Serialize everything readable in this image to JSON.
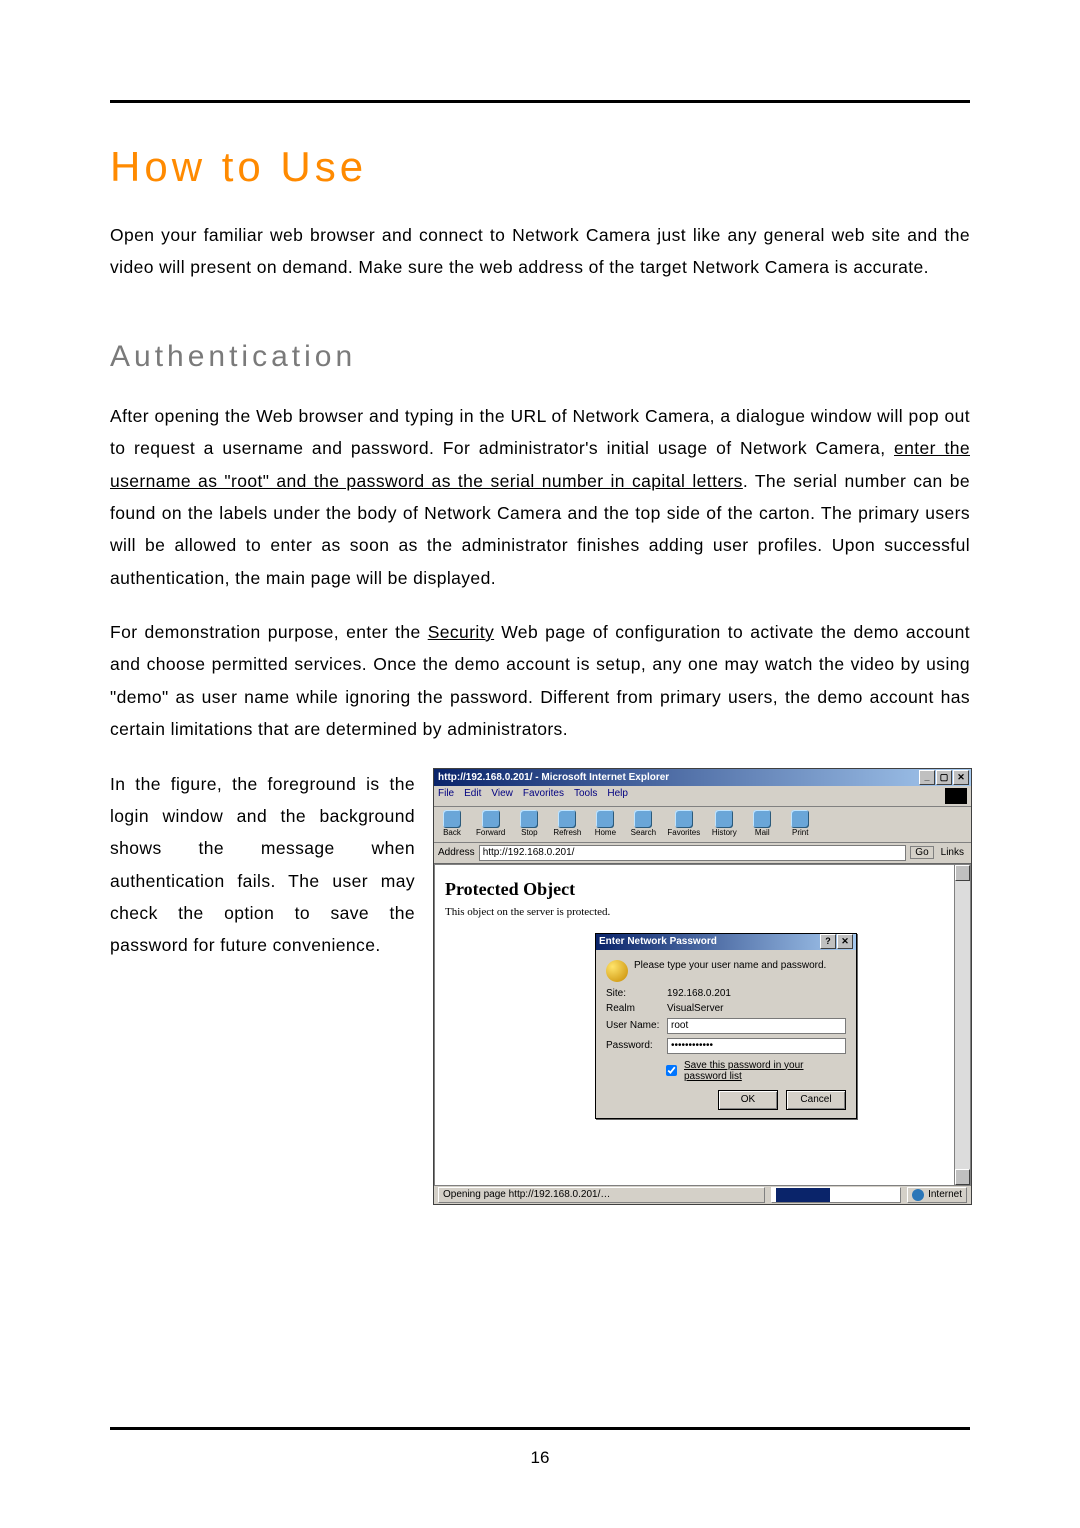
{
  "page_number": "16",
  "title": "How to Use",
  "intro": "Open your familiar web browser and connect to Network Camera just like any general web site and the video will present on demand. Make sure the web address of the target Network Camera is accurate.",
  "section_heading": "Authentication",
  "para1_a": "After opening the Web browser and typing in the URL of Network Camera, a dialogue window will pop out to request a username and password. For administrator's initial usage of Network Camera, ",
  "para1_u": "enter the username as \"root\" and the password as the serial number in capital letters",
  "para1_b": ". The serial number can be found on the labels under the body of Network Camera and the top side of the carton. The primary users will be allowed to enter as soon as the administrator finishes adding user profiles. Upon successful authentication, the main page will be displayed.",
  "para2_a": "For demonstration purpose, enter the ",
  "para2_u": "Security",
  "para2_b": " Web page of configuration to activate the demo account and choose permitted services. Once the demo account is setup, any one may watch the video by using \"demo\" as user name while ignoring the password. Different from primary users, the demo account has certain limitations that are determined by administrators.",
  "para3": "In the figure, the foreground is the login window and the background shows the message when authentication fails. The user may check the option to save the password for future convenience.",
  "ie": {
    "title": "http://192.168.0.201/ - Microsoft Internet Explorer",
    "menu": {
      "file": "File",
      "edit": "Edit",
      "view": "View",
      "fav": "Favorites",
      "tools": "Tools",
      "help": "Help"
    },
    "tb": {
      "back": "Back",
      "forward": "Forward",
      "stop": "Stop",
      "refresh": "Refresh",
      "home": "Home",
      "search": "Search",
      "favorites": "Favorites",
      "history": "History",
      "mail": "Mail",
      "print": "Print"
    },
    "address_label": "Address",
    "address_value": "http://192.168.0.201/",
    "go": "Go",
    "links": "Links",
    "page_heading": "Protected Object",
    "page_msg": "This object on the server is protected.",
    "status_text": "Opening page http://192.168.0.201/…",
    "zone": "Internet"
  },
  "dialog": {
    "title": "Enter Network Password",
    "hint": "Please type your user name and password.",
    "site_label": "Site:",
    "site_value": "192.168.0.201",
    "realm_label": "Realm",
    "realm_value": "VisualServer",
    "user_label": "User Name:",
    "user_value": "root",
    "pass_label": "Password:",
    "pass_value": "xxxxxxxxxxxx",
    "save_label": "Save this password in your password list",
    "ok": "OK",
    "cancel": "Cancel"
  }
}
